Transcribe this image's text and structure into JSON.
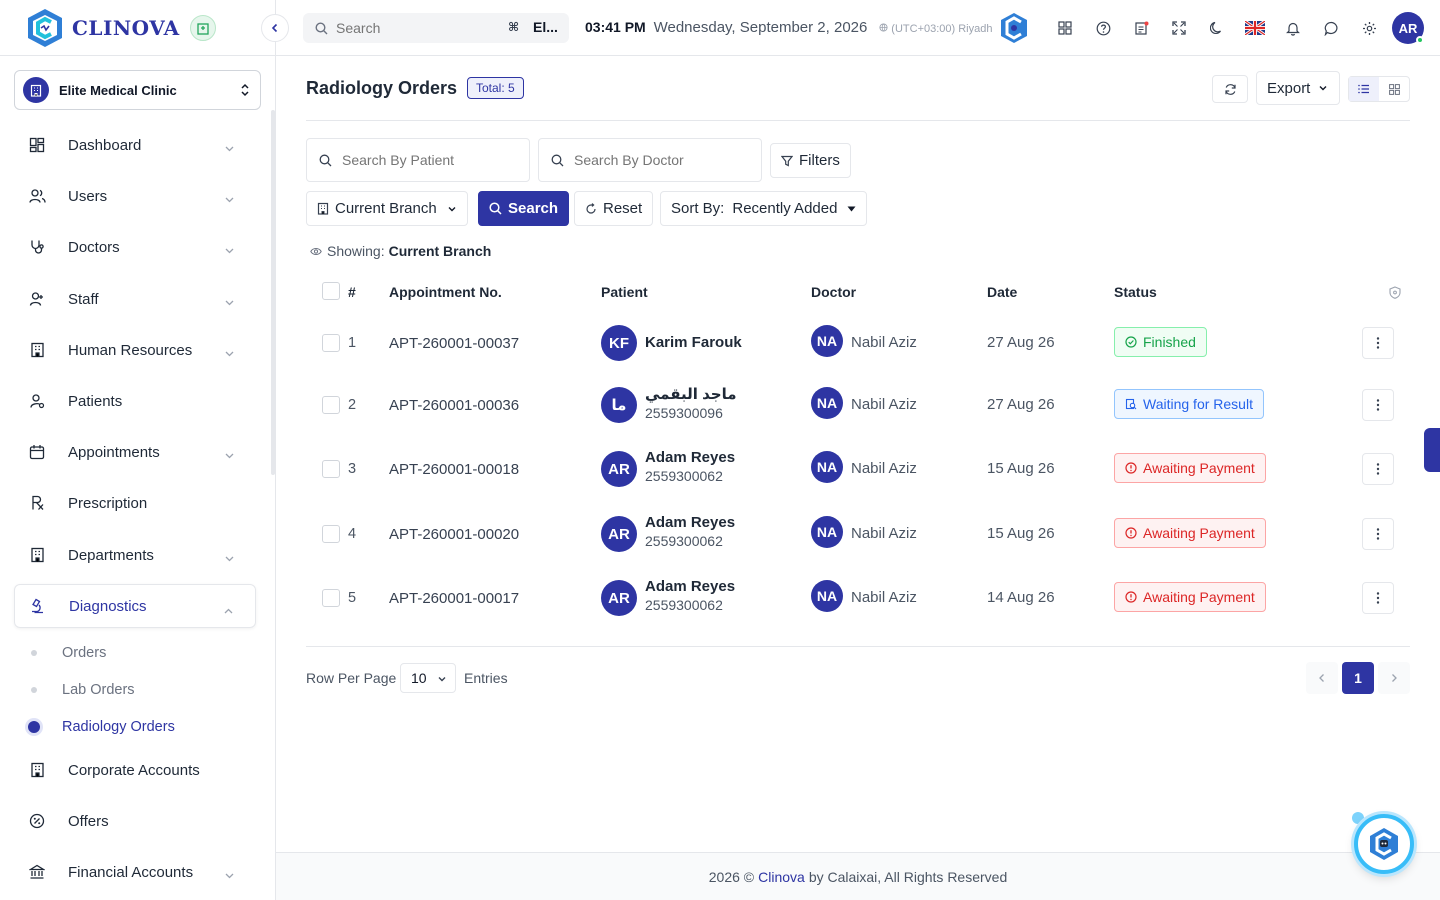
{
  "app": {
    "brand": "CLINOVA",
    "search_placeholder": "Search",
    "search_shortcut": "⌘",
    "search_scope": "El...",
    "time": "03:41 PM",
    "date": "Wednesday, September 2, 2026",
    "timezone": "(UTC+03:00) Riyadh",
    "user_initials": "AR",
    "accent_color": "#2e35a3"
  },
  "sidebar": {
    "clinic": "Elite Medical Clinic",
    "items": [
      {
        "label": "Dashboard",
        "icon": "dashboard-icon",
        "has_children": true
      },
      {
        "label": "Users",
        "icon": "users-icon",
        "has_children": true
      },
      {
        "label": "Doctors",
        "icon": "stethoscope-icon",
        "has_children": true
      },
      {
        "label": "Staff",
        "icon": "staff-icon",
        "has_children": true
      },
      {
        "label": "Human Resources",
        "icon": "building-icon",
        "has_children": true
      },
      {
        "label": "Patients",
        "icon": "patient-icon",
        "has_children": false
      },
      {
        "label": "Appointments",
        "icon": "calendar-icon",
        "has_children": true
      },
      {
        "label": "Prescription",
        "icon": "rx-icon",
        "has_children": false
      },
      {
        "label": "Departments",
        "icon": "building-icon",
        "has_children": true
      },
      {
        "label": "Diagnostics",
        "icon": "microscope-icon",
        "has_children": true,
        "expanded": true
      }
    ],
    "sub_items": [
      "Orders",
      "Lab Orders",
      "Radiology Orders"
    ],
    "active_sub": "Radiology Orders",
    "bottom_items": [
      {
        "label": "Corporate Accounts",
        "icon": "building-icon",
        "has_children": false
      },
      {
        "label": "Offers",
        "icon": "percent-icon",
        "has_children": false
      },
      {
        "label": "Financial Accounts",
        "icon": "bank-icon",
        "has_children": true
      }
    ]
  },
  "page": {
    "title": "Radiology Orders",
    "total": "Total: 5",
    "export_label": "Export"
  },
  "filters": {
    "patient_placeholder": "Search By Patient",
    "doctor_placeholder": "Search By Doctor",
    "filters_label": "Filters",
    "branch_label": "Current Branch",
    "search_label": "Search",
    "reset_label": "Reset",
    "sort_prefix": "Sort By:",
    "sort_value": "Recently Added",
    "showing_prefix": "Showing:",
    "showing_value": "Current Branch"
  },
  "table": {
    "headers": {
      "num": "#",
      "appointment": "Appointment No.",
      "patient": "Patient",
      "doctor": "Doctor",
      "date": "Date",
      "status": "Status"
    },
    "rows": [
      {
        "num": "1",
        "appointment": "APT-260001-00037",
        "patient_initials": "KF",
        "patient_name": "Karim Farouk",
        "patient_phone": "",
        "doctor_initials": "NA",
        "doctor_name": "Nabil Aziz",
        "date": "27 Aug 26",
        "status": "Finished",
        "status_kind": "green"
      },
      {
        "num": "2",
        "appointment": "APT-260001-00036",
        "patient_initials": "ما",
        "patient_name": "ماجد البقمي",
        "patient_phone": "2559300096",
        "doctor_initials": "NA",
        "doctor_name": "Nabil Aziz",
        "date": "27 Aug 26",
        "status": "Waiting for Result",
        "status_kind": "blue"
      },
      {
        "num": "3",
        "appointment": "APT-260001-00018",
        "patient_initials": "AR",
        "patient_name": "Adam Reyes",
        "patient_phone": "2559300062",
        "doctor_initials": "NA",
        "doctor_name": "Nabil Aziz",
        "date": "15 Aug 26",
        "status": "Awaiting Payment",
        "status_kind": "red"
      },
      {
        "num": "4",
        "appointment": "APT-260001-00020",
        "patient_initials": "AR",
        "patient_name": "Adam Reyes",
        "patient_phone": "2559300062",
        "doctor_initials": "NA",
        "doctor_name": "Nabil Aziz",
        "date": "15 Aug 26",
        "status": "Awaiting Payment",
        "status_kind": "red"
      },
      {
        "num": "5",
        "appointment": "APT-260001-00017",
        "patient_initials": "AR",
        "patient_name": "Adam Reyes",
        "patient_phone": "2559300062",
        "doctor_initials": "NA",
        "doctor_name": "Nabil Aziz",
        "date": "14 Aug 26",
        "status": "Awaiting Payment",
        "status_kind": "red"
      }
    ]
  },
  "pagination": {
    "rows_per_page_label": "Row Per Page",
    "rows_per_page": "10",
    "entries_label": "Entries",
    "current_page": "1"
  },
  "footer": {
    "prefix": "2026 ©",
    "brand": "Clinova",
    "suffix": "by Calaixai, All Rights Reserved"
  }
}
